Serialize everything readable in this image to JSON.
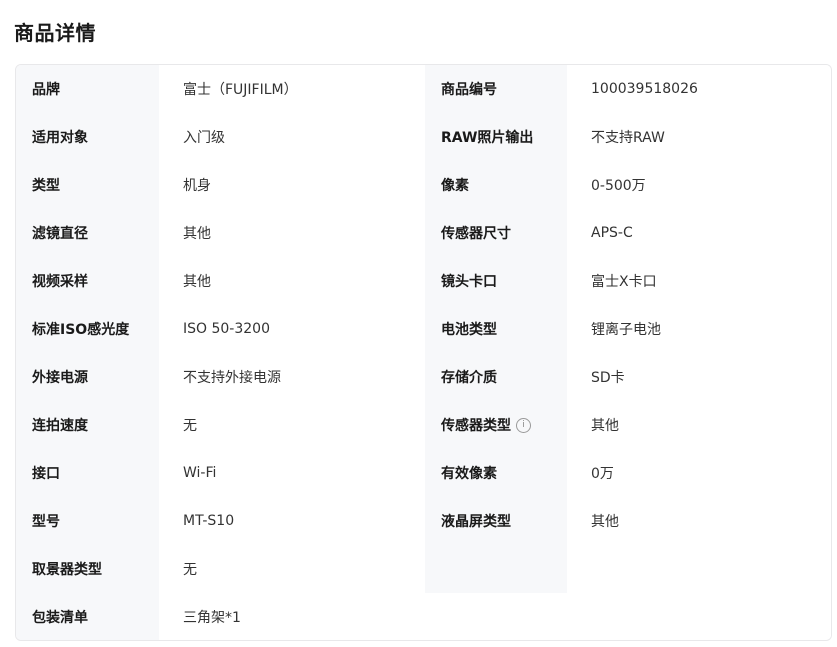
{
  "page": {
    "title": "商品详情"
  },
  "specs": {
    "rows": [
      {
        "k1": "品牌",
        "v1": "富士（FUJIFILM）",
        "k2": "商品编号",
        "v2": "100039518026"
      },
      {
        "k1": "适用对象",
        "v1": "入门级",
        "k2": "RAW照片输出",
        "v2": "不支持RAW"
      },
      {
        "k1": "类型",
        "v1": "机身",
        "k2": "像素",
        "v2": "0-500万"
      },
      {
        "k1": "滤镜直径",
        "v1": "其他",
        "k2": "传感器尺寸",
        "v2": "APS-C"
      },
      {
        "k1": "视频采样",
        "v1": "其他",
        "k2": "镜头卡口",
        "v2": "富士X卡口"
      },
      {
        "k1": "标准ISO感光度",
        "v1": "ISO 50-3200",
        "k2": "电池类型",
        "v2": "锂离子电池"
      },
      {
        "k1": "外接电源",
        "v1": "不支持外接电源",
        "k2": "存储介质",
        "v2": "SD卡"
      },
      {
        "k1": "连拍速度",
        "v1": "无",
        "k2": "传感器类型",
        "v2": "其他"
      },
      {
        "k1": "接口",
        "v1": "Wi-Fi",
        "k2": "有效像素",
        "v2": "0万"
      },
      {
        "k1": "型号",
        "v1": "MT-S10",
        "k2": "液晶屏类型",
        "v2": "其他"
      },
      {
        "k1": "取景器类型",
        "v1": "无",
        "k2": "",
        "v2": ""
      },
      {
        "k1": "包装清单",
        "v1": "三角架*1"
      }
    ],
    "info_icon": {
      "name": "info-icon",
      "glyph": "i"
    }
  }
}
